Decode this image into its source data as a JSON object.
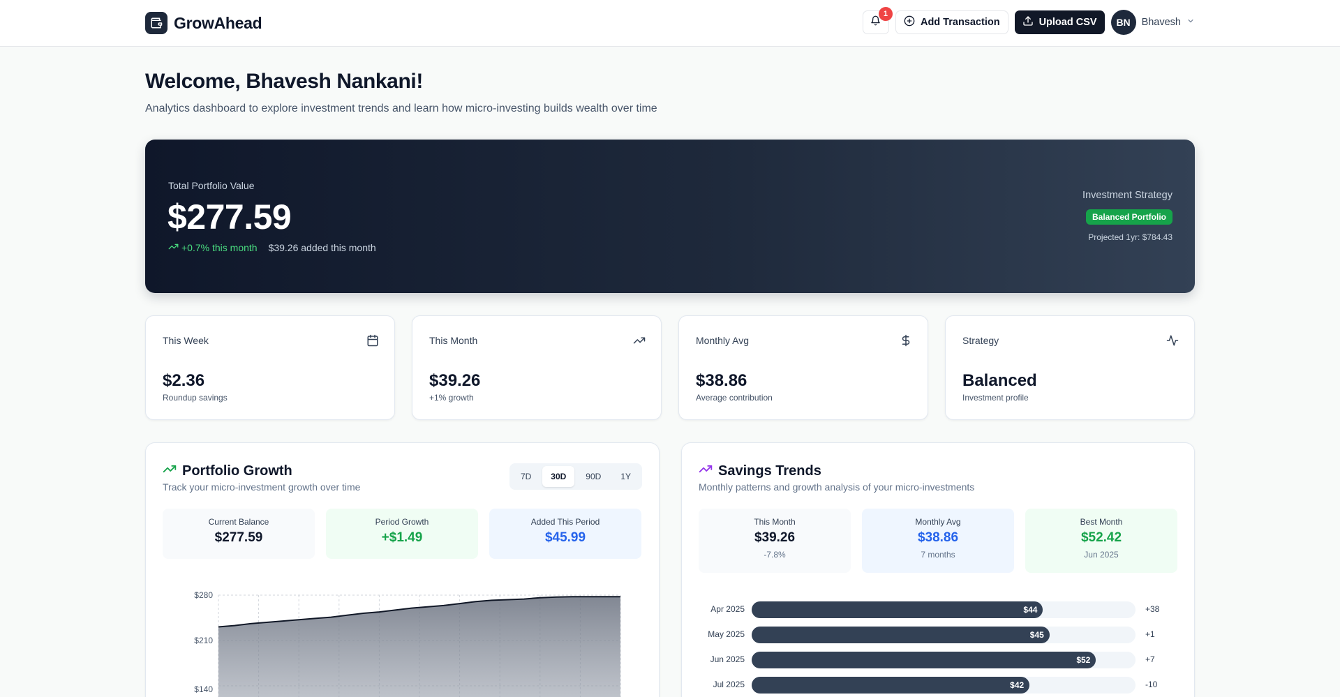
{
  "app": {
    "brand": "GrowAhead"
  },
  "header": {
    "notifications_count": "1",
    "add_transaction": "Add Transaction",
    "upload_csv": "Upload CSV",
    "user_initials": "BN",
    "user_name": "Bhavesh"
  },
  "welcome": {
    "title": "Welcome, Bhavesh Nankani!",
    "subtitle": "Analytics dashboard to explore investment trends and learn how micro-investing builds wealth over time"
  },
  "hero": {
    "label": "Total Portfolio Value",
    "value": "$277.59",
    "growth": "+0.7% this month",
    "added": "$39.26 added this month",
    "strategy_label": "Investment Strategy",
    "strategy_badge": "Balanced Portfolio",
    "projected": "Projected 1yr: $784.43",
    "colors": {
      "growth": "#4ade80",
      "badge": "#16a34a"
    }
  },
  "stats": [
    {
      "title": "This Week",
      "value": "$2.36",
      "sub": "Roundup savings",
      "icon": "calendar-icon"
    },
    {
      "title": "This Month",
      "value": "$39.26",
      "sub": "+1% growth",
      "icon": "trending-up-icon"
    },
    {
      "title": "Monthly Avg",
      "value": "$38.86",
      "sub": "Average contribution",
      "icon": "dollar-icon"
    },
    {
      "title": "Strategy",
      "value": "Balanced",
      "sub": "Investment profile",
      "icon": "activity-icon"
    }
  ],
  "portfolio": {
    "title": "Portfolio Growth",
    "subtitle": "Track your micro-investment growth over time",
    "ranges": [
      "7D",
      "30D",
      "90D",
      "1Y"
    ],
    "active_range": "30D",
    "summary": [
      {
        "label": "Current Balance",
        "value": "$277.59"
      },
      {
        "label": "Period Growth",
        "value": "+$1.49"
      },
      {
        "label": "Added This Period",
        "value": "$45.99"
      }
    ],
    "chart_data": {
      "type": "area",
      "ytick_labels": [
        "$280",
        "$210",
        "$140"
      ],
      "ytick_values": [
        280,
        210,
        140
      ],
      "values": [
        231,
        233,
        236,
        238,
        240,
        242,
        244,
        246,
        249,
        252,
        254,
        257,
        260,
        262,
        264,
        267,
        270,
        272,
        273,
        274,
        276,
        277,
        277.6,
        277.6,
        277.6,
        277.59
      ]
    }
  },
  "savings": {
    "title": "Savings Trends",
    "subtitle": "Monthly patterns and growth analysis of your micro-investments",
    "summary": [
      {
        "label": "This Month",
        "value": "$39.26",
        "note": "-7.8%"
      },
      {
        "label": "Monthly Avg",
        "value": "$38.86",
        "note": "7 months"
      },
      {
        "label": "Best Month",
        "value": "$52.42",
        "note": "Jun 2025"
      }
    ],
    "chart_data": {
      "type": "bar",
      "orientation": "horizontal",
      "categories": [
        "Apr 2025",
        "May 2025",
        "Jun 2025",
        "Jul 2025"
      ],
      "values": [
        44,
        45,
        52,
        42
      ],
      "value_labels": [
        "$44",
        "$45",
        "$52",
        "$42"
      ],
      "changes": [
        "+38",
        "+1",
        "+7",
        "-10"
      ],
      "max": 58
    }
  }
}
